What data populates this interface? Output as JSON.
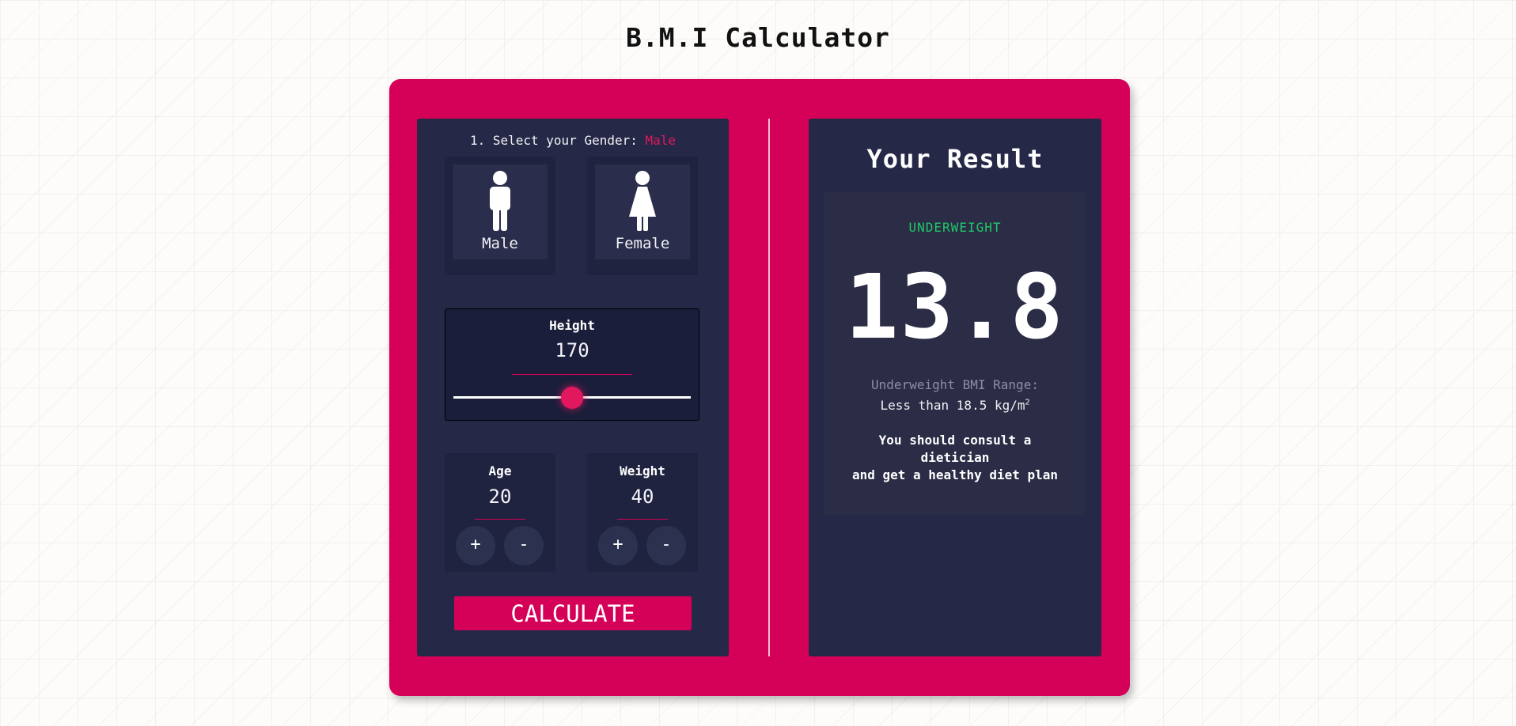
{
  "app": {
    "title": "B.M.I Calculator"
  },
  "gender": {
    "prompt": "1. Select your Gender: ",
    "selected": "Male",
    "options": [
      {
        "label": "Male",
        "icon": "male-icon"
      },
      {
        "label": "Female",
        "icon": "female-icon"
      }
    ]
  },
  "height": {
    "title": "Height",
    "value": "170",
    "slider_fraction": 0.5
  },
  "age": {
    "title": "Age",
    "value": "20",
    "plus": "+",
    "minus": "-"
  },
  "weight": {
    "title": "Weight",
    "value": "40",
    "plus": "+",
    "minus": "-"
  },
  "calculate_label": "CALCULATE",
  "result": {
    "title": "Your Result",
    "status": "UNDERWEIGHT",
    "bmi": "13.8",
    "range_label": "Underweight BMI Range:",
    "range_value": "Less than 18.5 kg/m",
    "range_unit_sup": "2",
    "advice_line1": "You should consult a dietician",
    "advice_line2": "and get a healthy diet plan"
  },
  "colors": {
    "accent": "#d50057",
    "panel": "#252846",
    "status_green": "#21c768"
  }
}
